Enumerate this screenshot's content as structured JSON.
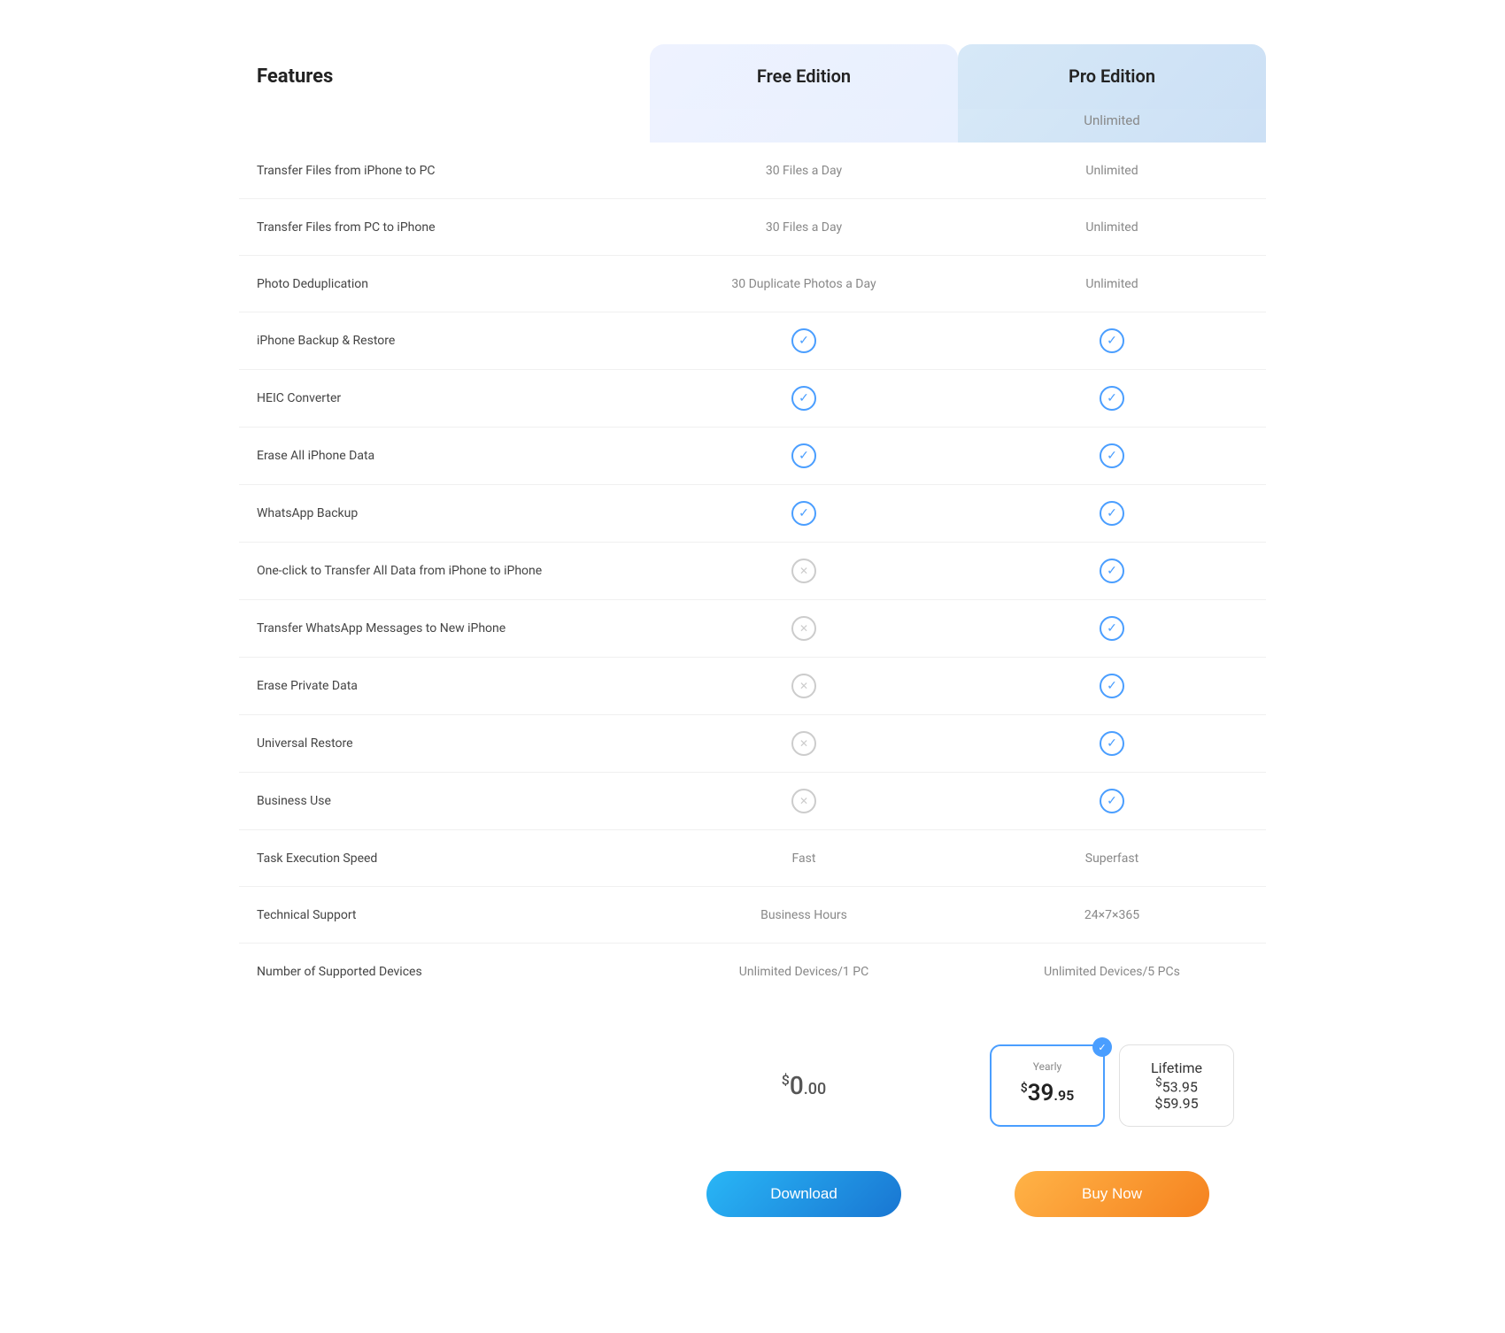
{
  "header": {
    "features_label": "Features",
    "free_edition_label": "Free Edition",
    "pro_edition_label": "Pro Edition"
  },
  "subheader": {
    "pro_unlimited": "Unlimited"
  },
  "features": [
    {
      "name": "Transfer Files from iPhone to PC",
      "free": "30 Files a Day",
      "free_type": "text",
      "pro": "Unlimited",
      "pro_type": "text"
    },
    {
      "name": "Transfer Files from PC to iPhone",
      "free": "30 Files a Day",
      "free_type": "text",
      "pro": "Unlimited",
      "pro_type": "text"
    },
    {
      "name": "Photo Deduplication",
      "free": "30 Duplicate Photos a Day",
      "free_type": "text",
      "pro": "Unlimited",
      "pro_type": "text"
    },
    {
      "name": "iPhone Backup & Restore",
      "free": "check",
      "free_type": "check",
      "pro": "check",
      "pro_type": "check"
    },
    {
      "name": "HEIC Converter",
      "free": "check",
      "free_type": "check",
      "pro": "check",
      "pro_type": "check"
    },
    {
      "name": "Erase All iPhone Data",
      "free": "check",
      "free_type": "check",
      "pro": "check",
      "pro_type": "check"
    },
    {
      "name": "WhatsApp Backup",
      "free": "check",
      "free_type": "check",
      "pro": "check",
      "pro_type": "check"
    },
    {
      "name": "One-click to Transfer All Data from iPhone to iPhone",
      "free": "x",
      "free_type": "x",
      "pro": "check",
      "pro_type": "check"
    },
    {
      "name": "Transfer WhatsApp Messages to New iPhone",
      "free": "x",
      "free_type": "x",
      "pro": "check",
      "pro_type": "check"
    },
    {
      "name": "Erase Private Data",
      "free": "x",
      "free_type": "x",
      "pro": "check",
      "pro_type": "check"
    },
    {
      "name": "Universal Restore",
      "free": "x",
      "free_type": "x",
      "pro": "check",
      "pro_type": "check"
    },
    {
      "name": "Business Use",
      "free": "x",
      "free_type": "x",
      "pro": "check",
      "pro_type": "check"
    },
    {
      "name": "Task Execution Speed",
      "free": "Fast",
      "free_type": "text",
      "pro": "Superfast",
      "pro_type": "text"
    },
    {
      "name": "Technical Support",
      "free": "Business Hours",
      "free_type": "text",
      "pro": "24×7×365",
      "pro_type": "text"
    },
    {
      "name": "Number of Supported Devices",
      "free": "Unlimited Devices/1 PC",
      "free_type": "text",
      "pro": "Unlimited Devices/5 PCs",
      "pro_type": "text"
    }
  ],
  "pricing": {
    "free_price_symbol": "$",
    "free_price_main": "0",
    "free_price_cents": ".00",
    "yearly_label": "Yearly",
    "yearly_price_symbol": "$",
    "yearly_price_main": "39",
    "yearly_price_cents": ".95",
    "lifetime_label": "Lifetime",
    "lifetime_price_symbol": "$",
    "lifetime_price_main": "53",
    "lifetime_price_cents": ".95",
    "lifetime_original": "$59.95"
  },
  "buttons": {
    "download_label": "Download",
    "buy_label": "Buy Now"
  }
}
